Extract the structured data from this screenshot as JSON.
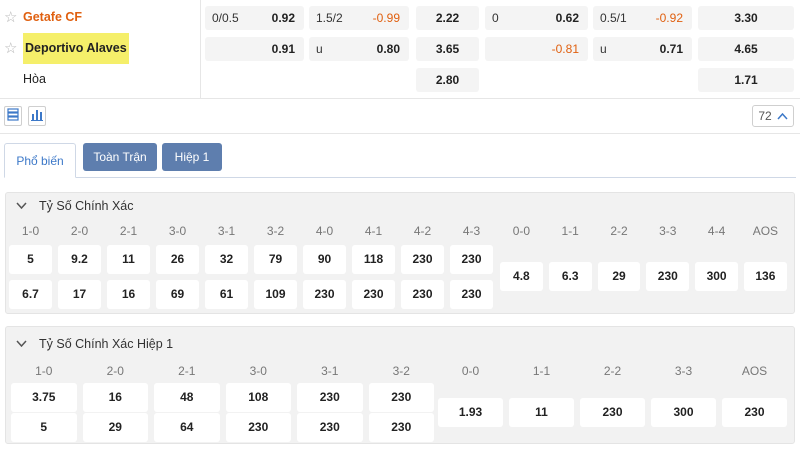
{
  "odds": {
    "rows": [
      {
        "team": "Getafe CF",
        "highlighted": false,
        "team_style": "orange",
        "cells": [
          {
            "label": "0/0.5",
            "value": "0.92",
            "negative": false
          },
          {
            "label": "1.5/2",
            "value": "-0.99",
            "negative": true
          },
          {
            "label": "",
            "value": "2.22",
            "negative": false
          },
          {
            "label": "0",
            "value": "0.62",
            "negative": false
          },
          {
            "label": "0.5/1",
            "value": "-0.92",
            "negative": true
          },
          {
            "label": "",
            "value": "3.30",
            "negative": false
          }
        ]
      },
      {
        "team": "Deportivo Alaves",
        "highlighted": true,
        "team_style": "highlight",
        "cells": [
          {
            "label": "",
            "value": "0.91",
            "negative": false
          },
          {
            "label": "u",
            "value": "0.80",
            "negative": false
          },
          {
            "label": "",
            "value": "3.65",
            "negative": false
          },
          {
            "label": "",
            "value": "-0.81",
            "negative": true
          },
          {
            "label": "u",
            "value": "0.71",
            "negative": false
          },
          {
            "label": "",
            "value": "4.65",
            "negative": false
          }
        ]
      },
      {
        "team": "Hòa",
        "highlighted": false,
        "team_style": "plain",
        "cells": [
          null,
          null,
          {
            "label": "",
            "value": "2.80",
            "negative": false
          },
          null,
          null,
          {
            "label": "",
            "value": "1.71",
            "negative": false
          }
        ]
      }
    ]
  },
  "toolbar": {
    "list_icon": "list-icon",
    "chart_icon": "bar-chart-icon",
    "market_count": "72",
    "collapse_icon": "chevron-up-icon"
  },
  "tabs": [
    {
      "label": "Phổ biến",
      "active": true
    },
    {
      "label": "Toàn Trận",
      "active": false
    },
    {
      "label": "Hiệp 1",
      "active": false
    }
  ],
  "markets": [
    {
      "title": "Tỷ Số Chính Xác",
      "groups": [
        {
          "type": "grid",
          "headers": [
            "1-0",
            "2-0",
            "2-1",
            "3-0",
            "3-1",
            "3-2",
            "4-0",
            "4-1",
            "4-2",
            "4-3"
          ],
          "rows": [
            [
              "5",
              "9.2",
              "11",
              "26",
              "32",
              "79",
              "90",
              "118",
              "230",
              "230"
            ],
            [
              "6.7",
              "17",
              "16",
              "69",
              "61",
              "109",
              "230",
              "230",
              "230",
              "230"
            ]
          ]
        },
        {
          "type": "single",
          "headers": [
            "0-0",
            "1-1",
            "2-2",
            "3-3",
            "4-4",
            "AOS"
          ],
          "values": [
            "4.8",
            "6.3",
            "29",
            "230",
            "300",
            "136"
          ]
        }
      ]
    },
    {
      "title": "Tỷ Số Chính Xác Hiệp 1",
      "groups": [
        {
          "type": "grid",
          "headers": [
            "1-0",
            "2-0",
            "2-1",
            "3-0",
            "3-1",
            "3-2"
          ],
          "rows": [
            [
              "3.75",
              "16",
              "48",
              "108",
              "230",
              "230"
            ],
            [
              "5",
              "29",
              "64",
              "230",
              "230",
              "230"
            ]
          ]
        },
        {
          "type": "single",
          "headers": [
            "0-0",
            "1-1",
            "2-2",
            "3-3",
            "AOS"
          ],
          "values": [
            "1.93",
            "11",
            "230",
            "300",
            "230"
          ]
        }
      ]
    }
  ]
}
